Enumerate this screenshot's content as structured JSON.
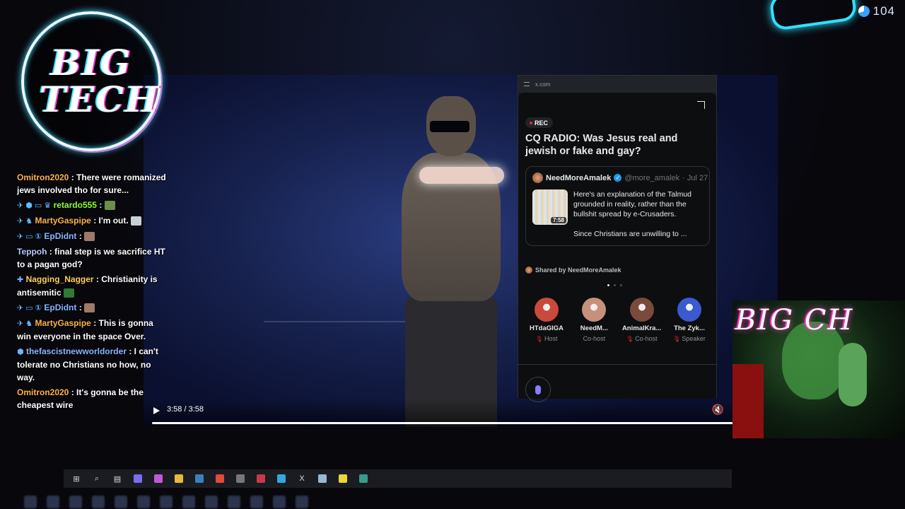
{
  "viewer_count": "104",
  "logo": {
    "line1": "BIG",
    "line2": "TECH"
  },
  "webcam_logo": "BIG  CH",
  "player": {
    "time": "3:58 / 3:58"
  },
  "chat": [
    {
      "user": "Omitron2020",
      "color": "#ffb347",
      "badges": "",
      "text": ": There were romanized jews involved tho for sure...",
      "emote": ""
    },
    {
      "user": "retardo555",
      "color": "#8fff3a",
      "badges": "✈ ⬢ ▭ ♛",
      "text": ":",
      "emote": "#6b8f4a"
    },
    {
      "user": "MartyGaspipe",
      "color": "#ffb347",
      "badges": "✈ ♞",
      "text": ": I'm out.",
      "emote": "#c8d0d8"
    },
    {
      "user": "EpDidnt",
      "color": "#8ab4ff",
      "badges": "✈ ▭ ①",
      "text": ":",
      "emote": "#a0786a"
    },
    {
      "user": "Teppoh",
      "color": "#b7c9ff",
      "badges": "",
      "text": ": final step is we sacrifice HT to a pagan god?",
      "emote": ""
    },
    {
      "user": "Nagging_Nagger",
      "color": "#ffcf5a",
      "badges": "✚",
      "text": ": Christianity is antisemitic",
      "emote": "#2f7a35"
    },
    {
      "user": "EpDidnt",
      "color": "#8ab4ff",
      "badges": "✈ ▭ ①",
      "text": ":",
      "emote": "#a0786a"
    },
    {
      "user": "MartyGaspipe",
      "color": "#ffb347",
      "badges": "✈ ♞",
      "text": ": This is gonna win everyone in the space Over.",
      "emote": ""
    },
    {
      "user": "thefascistnewworldorder",
      "color": "#8ab4ff",
      "badges": "⬢",
      "text": ": I can't tolerate no Christians no how, no way.",
      "emote": ""
    },
    {
      "user": "Omitron2020",
      "color": "#ffb347",
      "badges": "",
      "text": ": It's gonna be the cheapest wire",
      "emote": ""
    }
  ],
  "space": {
    "url": "x.com",
    "rec_label": "REC",
    "title": "CQ RADIO: Was Jesus real and jewish or fake and gay?",
    "tweet": {
      "author": "NeedMoreAmalek",
      "handle": "@more_amalek",
      "date": "· Jul 27",
      "video_duration": "7:58",
      "text_1": "Here's an explanation of the Talmud grounded in reality, rather than the bullshit spread by e-Crusaders.",
      "text_2": "Since Christians are unwilling to ..."
    },
    "shared_by": "Shared by NeedMoreAmalek",
    "participants": [
      {
        "name": "HTdaGIGA",
        "role": "Host",
        "color": "#c94a3a",
        "muted": true
      },
      {
        "name": "NeedM...",
        "role": "Co-host",
        "color": "#c7907a",
        "muted": false
      },
      {
        "name": "AnimalKra...",
        "role": "Co-host",
        "color": "#7a4a3a",
        "muted": true
      },
      {
        "name": "The Zyk...",
        "role": "Speaker",
        "color": "#3a5ad0",
        "muted": true
      }
    ]
  },
  "taskbar_icons": [
    {
      "name": "windows-icon",
      "glyph": "⊞",
      "color": ""
    },
    {
      "name": "search-icon",
      "glyph": "⌕",
      "color": ""
    },
    {
      "name": "task-view-icon",
      "glyph": "▤",
      "color": ""
    },
    {
      "name": "copilot-icon",
      "glyph": "",
      "color": "#7b6cf0"
    },
    {
      "name": "chrome-alt-icon",
      "glyph": "",
      "color": "#c259d8"
    },
    {
      "name": "file-explorer-icon",
      "glyph": "",
      "color": "#e8b93a"
    },
    {
      "name": "steam-icon",
      "glyph": "",
      "color": "#3b7fc0"
    },
    {
      "name": "chrome-icon",
      "glyph": "",
      "color": "#e24a3a"
    },
    {
      "name": "obs-icon",
      "glyph": "",
      "color": "#777777"
    },
    {
      "name": "stream-tool-icon",
      "glyph": "",
      "color": "#c83a4a"
    },
    {
      "name": "telegram-icon",
      "glyph": "",
      "color": "#35a6e0"
    },
    {
      "name": "x-icon",
      "glyph": "X",
      "color": ""
    },
    {
      "name": "notepad-icon",
      "glyph": "",
      "color": "#9ab8d0"
    },
    {
      "name": "sticky-notes-icon",
      "glyph": "",
      "color": "#e8d63a"
    },
    {
      "name": "terminal-icon",
      "glyph": "",
      "color": "#3a9a8a"
    }
  ]
}
